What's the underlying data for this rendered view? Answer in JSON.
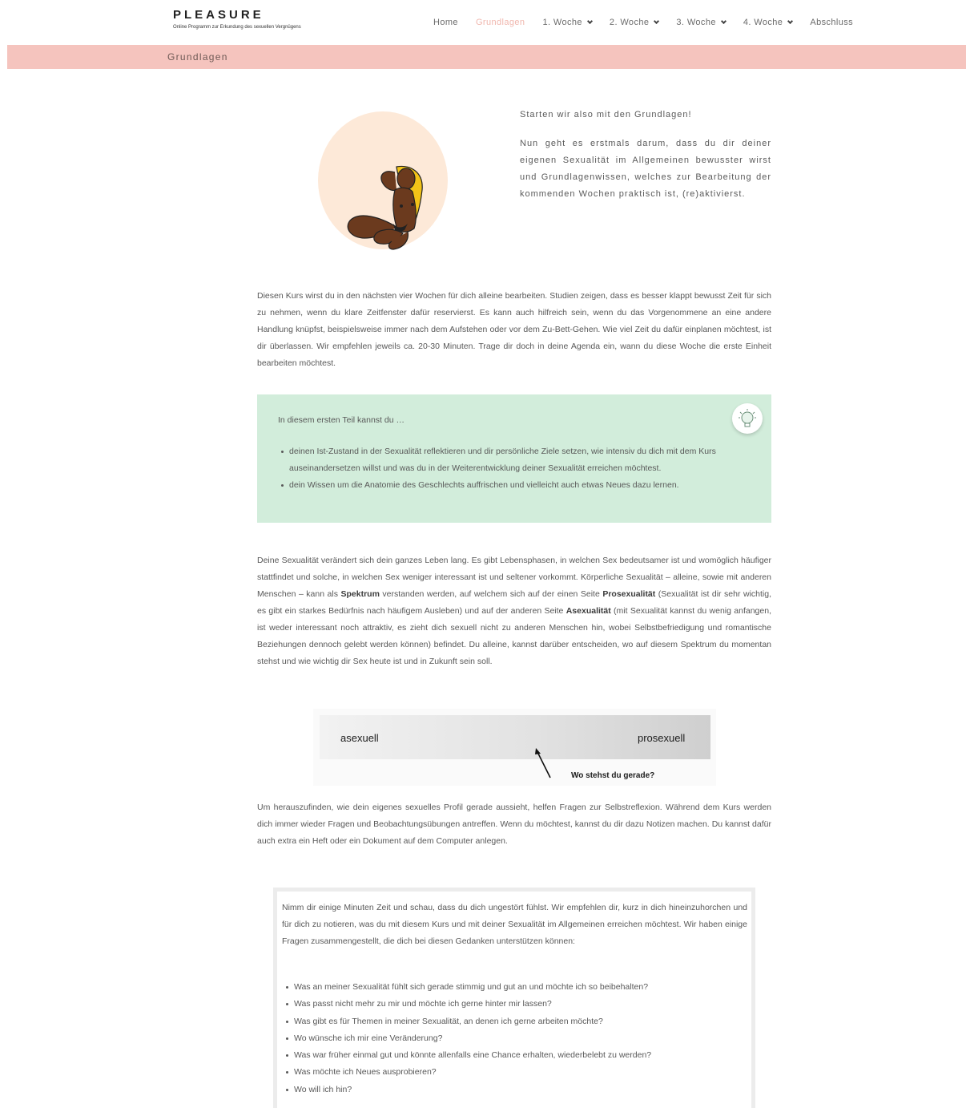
{
  "header": {
    "logo_title": "PLEASURE",
    "logo_subtitle": "Online Programm zur Erkundung des sexuellen Vergnügens",
    "nav": [
      {
        "label": "Home",
        "active": false,
        "dropdown": false
      },
      {
        "label": "Grundlagen",
        "active": true,
        "dropdown": false
      },
      {
        "label": "1. Woche",
        "active": false,
        "dropdown": true
      },
      {
        "label": "2. Woche",
        "active": false,
        "dropdown": true
      },
      {
        "label": "3. Woche",
        "active": false,
        "dropdown": true
      },
      {
        "label": "4. Woche",
        "active": false,
        "dropdown": true
      },
      {
        "label": "Abschluss",
        "active": false,
        "dropdown": false
      }
    ],
    "active_color": "#f0b7ae"
  },
  "band": {
    "title": "Grundlagen",
    "color": "#f5c4be"
  },
  "intro": {
    "heading": "Starten wir also mit den Grundlagen!",
    "text": "Nun geht es erstmals darum, dass du dir deiner eigenen Sexualität im Allgemeinen bewusster wirst und Grundlagenwissen, welches zur Bearbeitung der kommenden Wochen praktisch ist, (re)aktivierst.",
    "illustration": "seated-woman-illustration"
  },
  "paragraph1": "Diesen Kurs wirst du in den nächsten vier Wochen für dich alleine bearbeiten. Studien zeigen, dass es besser klappt bewusst Zeit für sich zu nehmen, wenn du klare Zeitfenster dafür reservierst. Es kann auch hilfreich sein, wenn du das Vorgenommene an eine andere Handlung knüpfst, beispielsweise immer nach dem Aufstehen oder vor dem Zu-Bett-Gehen. Wie viel Zeit du dafür einplanen möchtest, ist dir überlassen. Wir empfehlen jeweils ca. 20-30 Minuten. Trage dir doch in deine Agenda ein, wann du diese Woche die erste Einheit bearbeiten möchtest.",
  "infobox": {
    "intro": "In diesem ersten Teil kannst du …",
    "items": [
      "deinen Ist-Zustand in der Sexualität reflektieren und dir persönliche Ziele setzen, wie intensiv du dich mit dem Kurs auseinandersetzen willst und was du in der Weiterentwicklung deiner Sexualität erreichen möchtest.",
      "dein Wissen um die Anatomie des Geschlechts auffrischen und vielleicht auch etwas Neues dazu lernen."
    ],
    "icon": "lightbulb-icon",
    "color": "#d2eddb"
  },
  "paragraph2": {
    "part1": "Deine Sexualität verändert sich dein ganzes Leben lang. Es gibt Lebensphasen, in welchen Sex bedeutsamer ist und womöglich häufiger stattfindet und solche, in welchen Sex weniger interessant ist und seltener vorkommt. Körperliche Sexualität – alleine, sowie mit anderen Menschen – kann als ",
    "bold1": "Spektrum",
    "part2": " verstanden werden, auf welchem sich auf der einen Seite ",
    "bold2": "Prosexualität",
    "part3": " (Sexualität ist dir sehr wichtig, es gibt ein starkes Bedürfnis nach häufigem Ausleben) und auf der anderen Seite ",
    "bold3": "Asexualität",
    "part4": " (mit Sexualität kannst du wenig anfangen, ist weder interessant noch attraktiv, es zieht dich sexuell nicht zu anderen Menschen hin, wobei Selbstbefriedigung und romantische Beziehungen dennoch gelebt werden können) befindet. Du alleine, kannst darüber entscheiden, wo auf diesem Spektrum du momentan stehst und wie wichtig dir Sex heute ist und in Zukunft sein soll."
  },
  "spectrum": {
    "left_label": "asexuell",
    "right_label": "prosexuell",
    "question": "Wo stehst du gerade?"
  },
  "paragraph3": "Um herauszufinden, wie dein eigenes sexuelles Profil gerade aussieht, helfen Fragen zur Selbstreflexion. Während dem Kurs werden dich immer wieder Fragen und Beobachtungsübungen antreffen. Wenn du möchtest, kannst du dir dazu Notizen machen. Du kannst dafür auch extra ein Heft oder ein Dokument auf dem Computer anlegen.",
  "reflection_box": {
    "text": "Nimm dir einige Minuten Zeit und schau, dass du dich ungestört fühlst. Wir empfehlen dir, kurz in dich hineinzuhorchen und für dich zu notieren, was du mit diesem Kurs und mit deiner Sexualität im Allgemeinen erreichen möchtest. Wir haben einige Fragen zusammengestellt, die dich bei diesen Gedanken unterstützen können:",
    "questions": [
      "Was an meiner Sexualität fühlt sich gerade stimmig und gut an und möchte ich so beibehalten?",
      "Was passt nicht mehr zu mir und möchte ich gerne hinter mir lassen?",
      "Was gibt es für Themen in meiner Sexualität, an denen ich gerne arbeiten möchte?",
      "Wo wünsche ich mir eine Veränderung?",
      "Was war früher einmal gut und könnte allenfalls eine Chance erhalten, wiederbelebt zu werden?",
      "Was möchte ich Neues ausprobieren?",
      "Wo will ich hin?"
    ]
  }
}
